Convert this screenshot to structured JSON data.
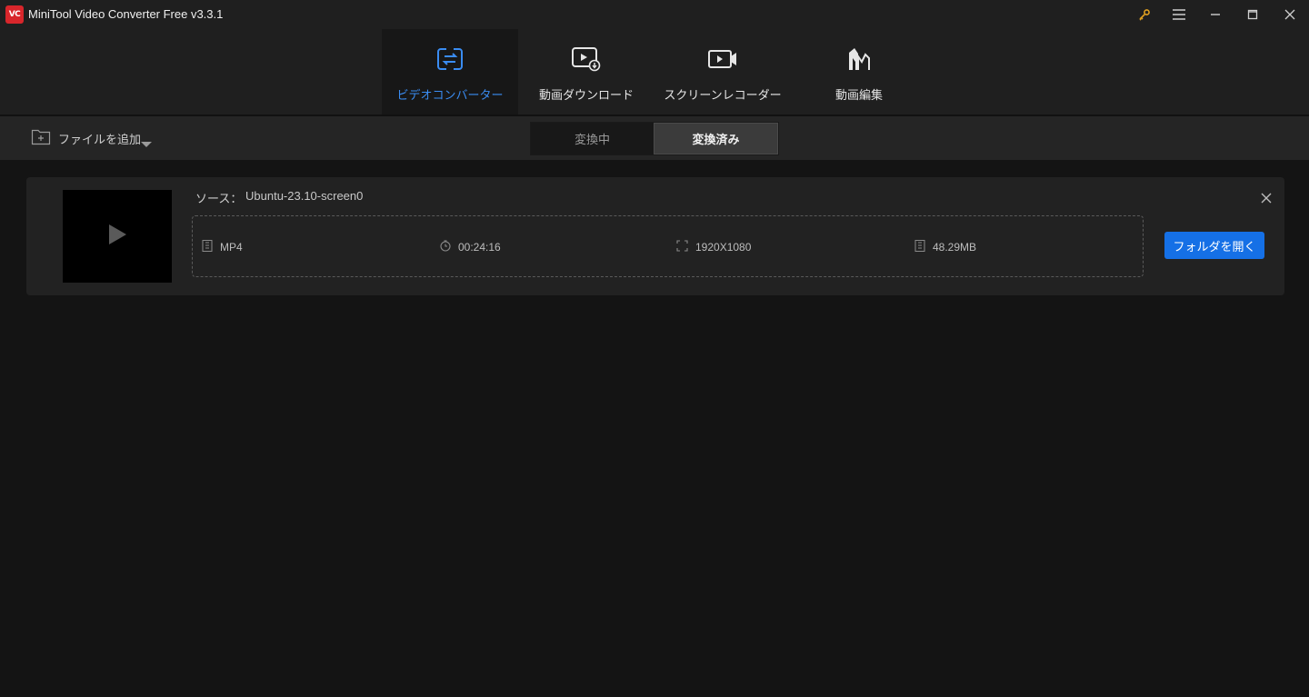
{
  "window": {
    "logo_text": "VC",
    "title": "MiniTool Video Converter Free v3.3.1",
    "controls": [
      "key-icon",
      "menu-icon",
      "minimize-icon",
      "maximize-icon",
      "close-icon"
    ]
  },
  "nav": {
    "tabs": [
      {
        "label": "ビデオコンバーター",
        "icon": "convert-icon",
        "active": true
      },
      {
        "label": "動画ダウンロード",
        "icon": "video-download-icon",
        "active": false
      },
      {
        "label": "スクリーンレコーダー",
        "icon": "screen-record-icon",
        "active": false
      },
      {
        "label": "動画編集",
        "icon": "video-edit-icon",
        "active": false
      }
    ]
  },
  "toolbar": {
    "add_file_label": "ファイルを追加",
    "segments": [
      {
        "label": "変換中",
        "active": false
      },
      {
        "label": "変換済み",
        "active": true
      }
    ]
  },
  "item": {
    "source_label": "ソース：",
    "source_name": "Ubuntu-23.10-screen0",
    "format": "MP4",
    "duration": "00:24:16",
    "resolution": "1920X1080",
    "size": "48.29MB",
    "open_folder_label": "フォルダを開く"
  },
  "colors": {
    "accent": "#1570e6",
    "active_tab_text": "#3a8cf2",
    "logo": "#d8262b",
    "key_icon": "#e0a020"
  }
}
